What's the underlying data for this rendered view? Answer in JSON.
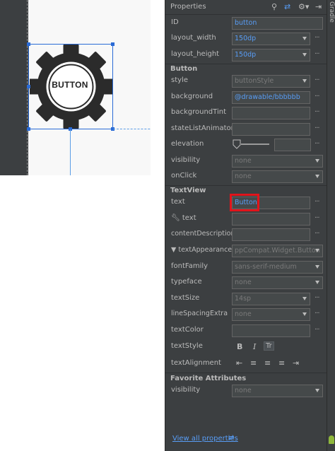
{
  "canvas": {
    "button_label": "BUTTON"
  },
  "panel": {
    "title": "Properties",
    "header_icons": [
      "search-icon",
      "swap-arrows-icon",
      "gear-icon",
      "pin-icon"
    ],
    "side_tab_label": "Gradle",
    "rows": {
      "id": {
        "label": "ID",
        "value": "button"
      },
      "layout_width": {
        "label": "layout_width",
        "value": "150dp"
      },
      "layout_height": {
        "label": "layout_height",
        "value": "150dp"
      },
      "style": {
        "label": "style",
        "value": "buttonStyle"
      },
      "background": {
        "label": "background",
        "value": "@drawable/bbbbbb"
      },
      "backgroundTint": {
        "label": "backgroundTint",
        "value": ""
      },
      "stateListAnimator": {
        "label": "stateListAnimator",
        "value": ""
      },
      "elevation": {
        "label": "elevation",
        "value": ""
      },
      "visibility": {
        "label": "visibility",
        "value": "none"
      },
      "onClick": {
        "label": "onClick",
        "value": "none"
      },
      "text": {
        "label": "text",
        "value": "Button"
      },
      "tools_text": {
        "label": "text",
        "value": ""
      },
      "contentDescription": {
        "label": "contentDescription",
        "value": ""
      },
      "textAppearance": {
        "label": "textAppearance",
        "value": "ppCompat.Widget.Button"
      },
      "fontFamily": {
        "label": "fontFamily",
        "value": "sans-serif-medium"
      },
      "typeface": {
        "label": "typeface",
        "value": "none"
      },
      "textSize": {
        "label": "textSize",
        "value": "14sp"
      },
      "lineSpacingExtra": {
        "label": "lineSpacingExtra",
        "value": "none"
      },
      "textColor": {
        "label": "textColor",
        "value": ""
      },
      "textStyle": {
        "label": "textStyle"
      },
      "textAlignment": {
        "label": "textAlignment"
      },
      "fav_visibility": {
        "label": "visibility",
        "value": "none"
      }
    },
    "sections": {
      "button": "Button",
      "textview": "TextView",
      "favorites": "Favorite Attributes"
    },
    "text_style_buttons": [
      "B",
      "I",
      "Tr"
    ],
    "view_all_link": "View all properties"
  },
  "colors": {
    "accent": "#589df6",
    "highlight": "#e1141b",
    "selection": "#2a6bd6"
  }
}
